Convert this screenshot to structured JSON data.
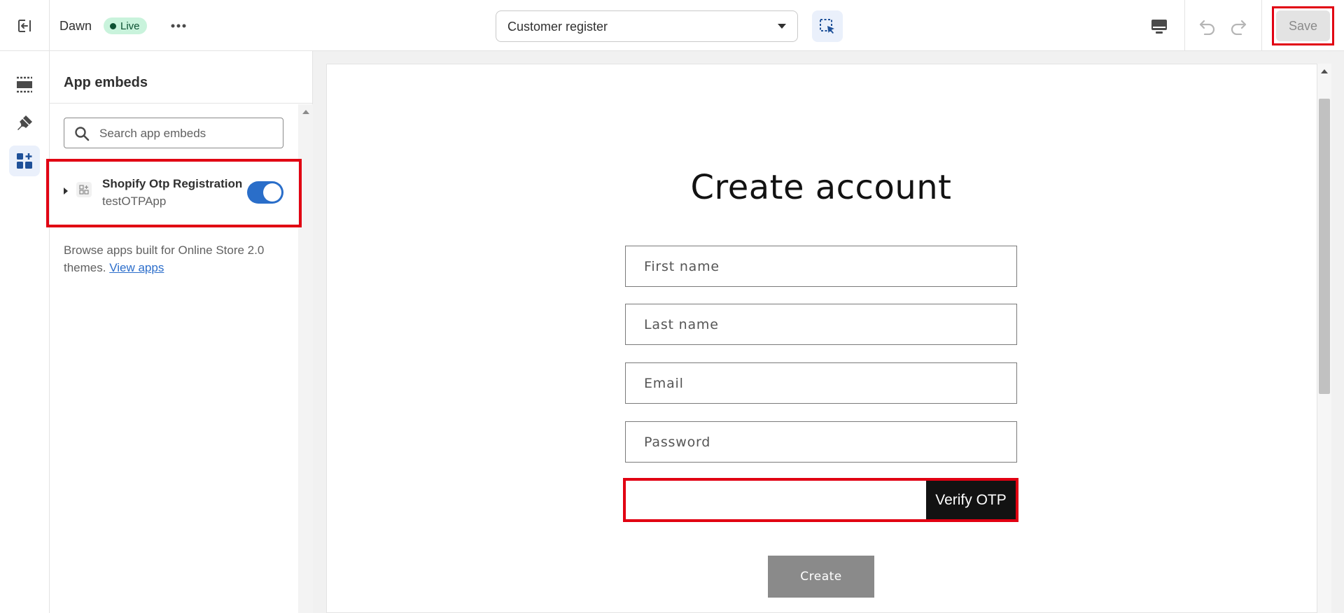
{
  "topbar": {
    "theme_name": "Dawn",
    "live_badge": "Live",
    "page_select_value": "Customer register",
    "save_label": "Save"
  },
  "rail": {
    "items": [
      {
        "icon": "sections-icon"
      },
      {
        "icon": "theme-settings-icon"
      },
      {
        "icon": "app-embeds-icon",
        "active": true
      }
    ]
  },
  "sidebar": {
    "title": "App embeds",
    "search_placeholder": "Search app embeds",
    "embed": {
      "title": "Shopify Otp Registration",
      "subtitle": "testOTPApp",
      "enabled": true
    },
    "browse_text": "Browse apps built for Online Store 2.0 themes.",
    "browse_link": "View apps"
  },
  "preview": {
    "heading": "Create account",
    "fields": [
      {
        "placeholder": "First name"
      },
      {
        "placeholder": "Last name"
      },
      {
        "placeholder": "Email"
      },
      {
        "placeholder": "Password"
      }
    ],
    "otp_button": "Verify OTP",
    "create_button": "Create"
  },
  "colors": {
    "accent": "#2a6ec9",
    "highlight": "#e10012",
    "live_badge_bg": "#c9f3dc"
  }
}
